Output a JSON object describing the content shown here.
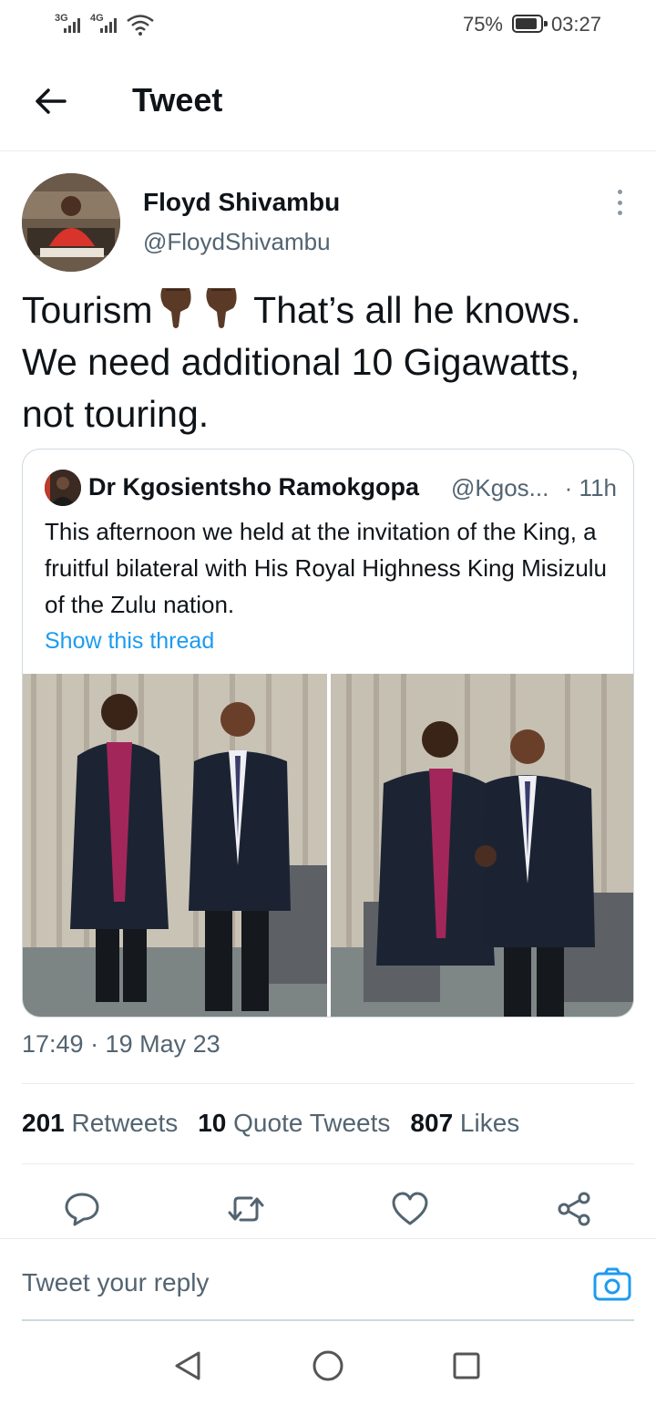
{
  "status_bar": {
    "signal_1": "3G",
    "signal_2": "4G",
    "battery": "75%",
    "time": "03:27"
  },
  "header": {
    "title": "Tweet"
  },
  "tweet": {
    "author_name": "Floyd Shivambu",
    "author_handle": "@FloydShivambu",
    "text_part1": "Tourism",
    "text_part2": " That’s all he knows. We need additional 10 Gigawatts, not touring.",
    "timestamp": "17:49 · 19 May 23"
  },
  "quoted_tweet": {
    "author_name": "Dr Kgosientsho Ramokgopa",
    "author_handle": "@Kgos...",
    "time": "· 11h",
    "text": "This afternoon we held at the invitation of the King, a fruitful bilateral with His Royal Highness King Misizulu of the Zulu nation.",
    "show_thread": "Show this thread"
  },
  "stats": {
    "retweets_count": "201",
    "retweets_label": "Retweets",
    "quote_count": "10",
    "quote_label": "Quote Tweets",
    "likes_count": "807",
    "likes_label": "Likes"
  },
  "reply": {
    "placeholder": "Tweet your reply"
  },
  "icons": {
    "back": "arrow-left-icon",
    "more": "vertical-dots-icon",
    "reply": "speech-bubble-icon",
    "retweet": "retweet-icon",
    "like": "heart-icon",
    "share": "share-icon",
    "camera": "camera-icon",
    "emoji": "backhand-index-pointing-down-emoji"
  },
  "colors": {
    "link": "#1d9bf0",
    "secondary_text": "#536471",
    "primary_text": "#0f1419",
    "divider": "#e6ecf0"
  }
}
